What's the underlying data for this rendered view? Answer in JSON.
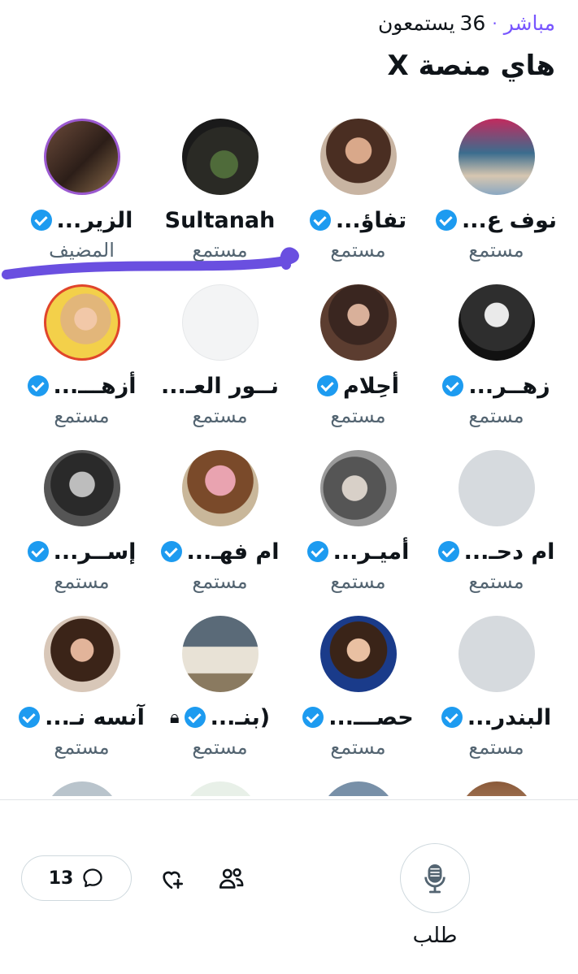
{
  "header": {
    "live_label": "مباشر",
    "listeners_count": "36",
    "listeners_label": "يستمعون",
    "title": "هاي منصة X"
  },
  "participants": [
    {
      "name": "نوف ع...",
      "role": "مستمع",
      "verified": true
    },
    {
      "name": "تفاؤ...",
      "role": "مستمع",
      "verified": true
    },
    {
      "name": "Sultanah",
      "role": "مستمع",
      "verified": false
    },
    {
      "name": "الزير...",
      "role": "المضيف",
      "verified": true
    },
    {
      "name": "زهــر...",
      "role": "مستمع",
      "verified": true
    },
    {
      "name": "أحِلام",
      "role": "مستمع",
      "verified": true
    },
    {
      "name": "نــور العـ...",
      "role": "مستمع",
      "verified": false
    },
    {
      "name": "أزهـــ...",
      "role": "مستمع",
      "verified": true
    },
    {
      "name": "ام دحـ...",
      "role": "مستمع",
      "verified": true
    },
    {
      "name": "أميـر...",
      "role": "مستمع",
      "verified": true
    },
    {
      "name": "ام فهـ...",
      "role": "مستمع",
      "verified": true
    },
    {
      "name": "إســر...",
      "role": "مستمع",
      "verified": true
    },
    {
      "name": "البندر...",
      "role": "مستمع",
      "verified": true
    },
    {
      "name": "حصـــ...",
      "role": "مستمع",
      "verified": true
    },
    {
      "name": "(بنـ...",
      "role": "مستمع",
      "verified": true,
      "locked": true
    },
    {
      "name": "آنسه نـ...",
      "role": "مستمع",
      "verified": true
    }
  ],
  "footer": {
    "comments_count": "13",
    "request_label": "طلب"
  },
  "colors": {
    "accent_purple": "#7856ff",
    "verified_blue": "#1d9bf0",
    "secondary_text": "#536471",
    "scribble": "#6a4fe0"
  },
  "icons": {
    "comment": "comment-icon",
    "heart_add": "heart-plus-icon",
    "people": "people-icon",
    "mic": "microphone-icon",
    "verified": "verified-badge-icon",
    "lock": "lock-icon"
  }
}
